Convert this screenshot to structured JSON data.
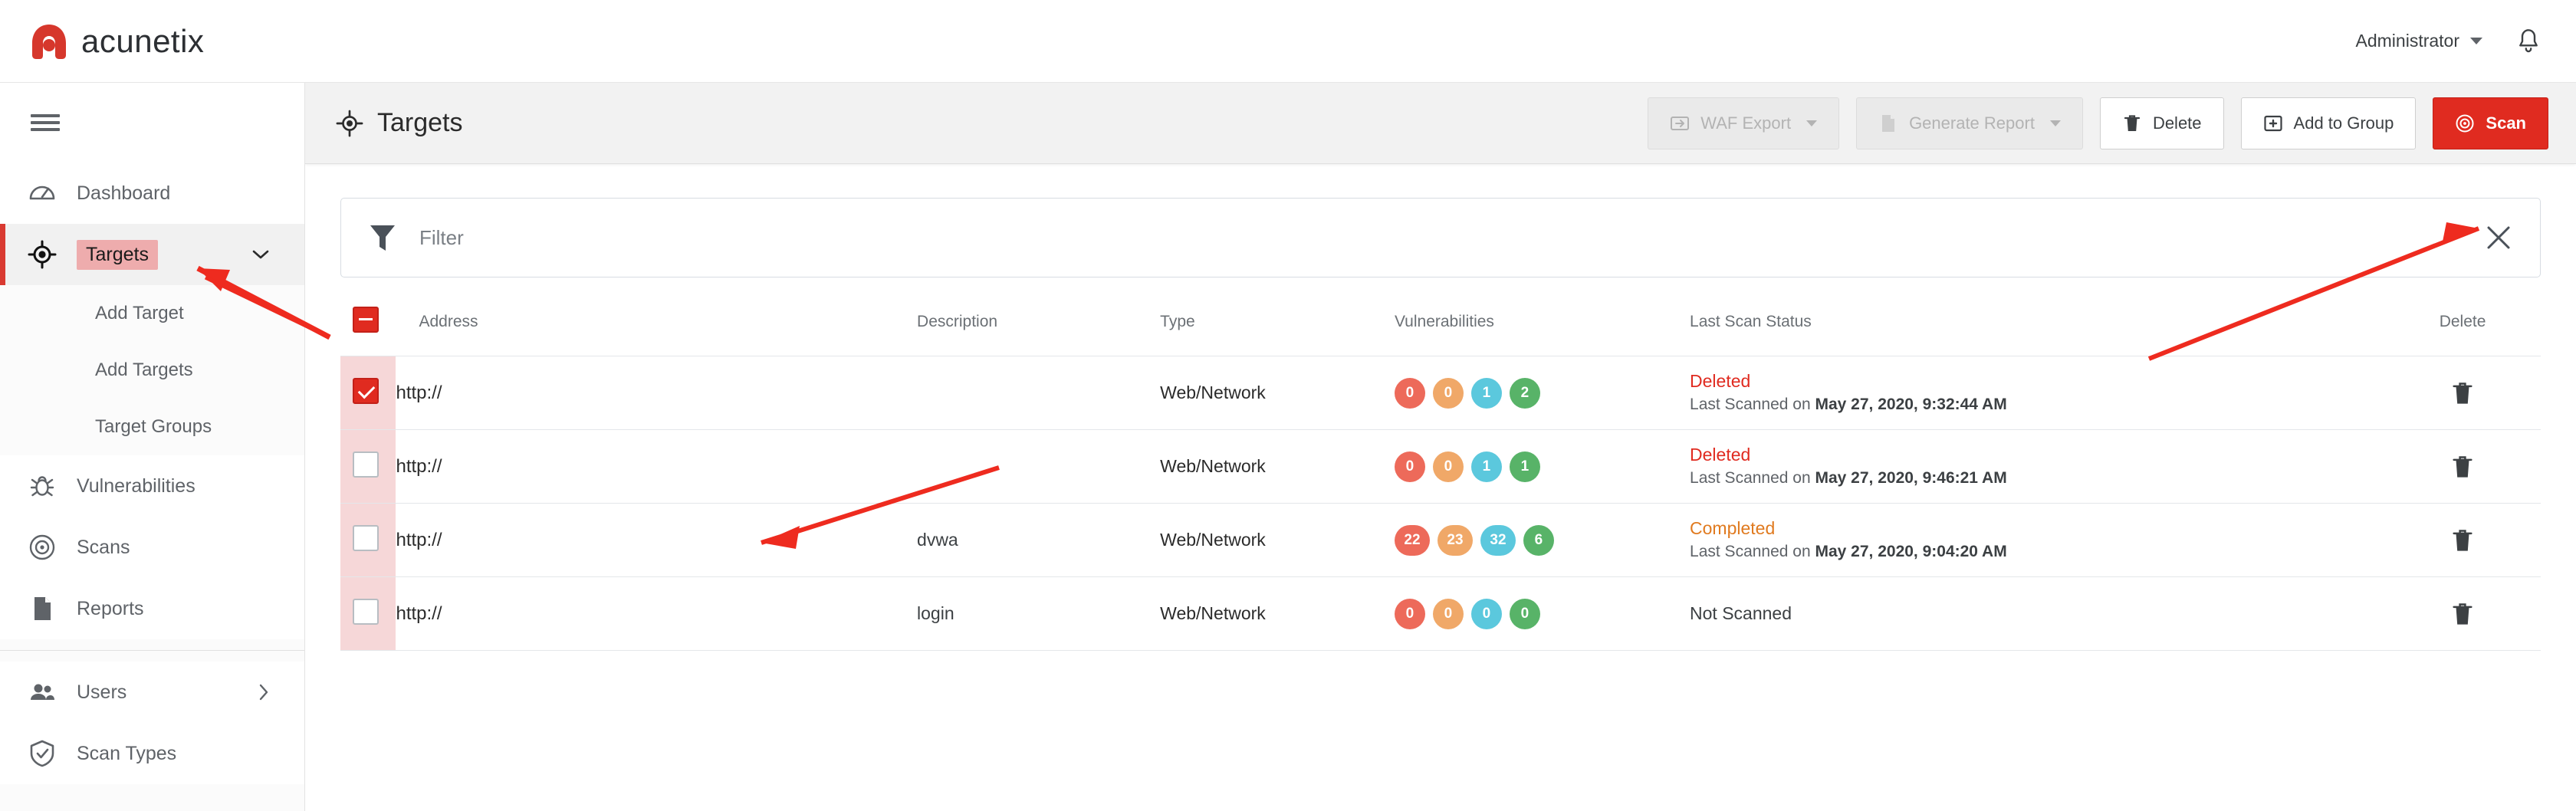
{
  "brand": {
    "name": "acunetix",
    "logo_icon": "acunetix-logo-icon"
  },
  "topbar": {
    "user_label": "Administrator",
    "user_caret_icon": "chevron-down-icon",
    "notifications_icon": "bell-icon"
  },
  "sidebar": {
    "menu_icon": "hamburger-menu-icon",
    "items": [
      {
        "label": "Dashboard",
        "icon": "dashboard-gauge-icon",
        "active": false,
        "expandable": false
      },
      {
        "label": "Targets",
        "icon": "crosshair-target-icon",
        "active": true,
        "expandable": true,
        "chevron_icon": "chevron-down-icon"
      },
      {
        "label": "Vulnerabilities",
        "icon": "bug-icon",
        "active": false,
        "expandable": false
      },
      {
        "label": "Scans",
        "icon": "radar-scan-icon",
        "active": false,
        "expandable": false
      },
      {
        "label": "Reports",
        "icon": "document-report-icon",
        "active": false,
        "expandable": false
      },
      {
        "label": "Users",
        "icon": "users-icon",
        "active": false,
        "expandable": true,
        "chevron_icon": "chevron-right-icon"
      },
      {
        "label": "Scan Types",
        "icon": "shield-icon",
        "active": false,
        "expandable": false
      }
    ],
    "sub_items": [
      {
        "label": "Add Target"
      },
      {
        "label": "Add Targets"
      },
      {
        "label": "Target Groups"
      }
    ]
  },
  "page": {
    "title": "Targets",
    "title_icon": "crosshair-target-icon"
  },
  "toolbar": {
    "buttons": [
      {
        "label": "WAF Export",
        "icon": "waf-export-icon",
        "disabled": true,
        "caret": true,
        "primary": false
      },
      {
        "label": "Generate Report",
        "icon": "report-page-icon",
        "disabled": true,
        "caret": true,
        "primary": false
      },
      {
        "label": "Delete",
        "icon": "trash-icon",
        "disabled": false,
        "caret": false,
        "primary": false
      },
      {
        "label": "Add to Group",
        "icon": "add-to-group-icon",
        "disabled": false,
        "caret": false,
        "primary": false
      },
      {
        "label": "Scan",
        "icon": "scan-radar-icon",
        "disabled": false,
        "caret": false,
        "primary": true
      }
    ]
  },
  "filter": {
    "icon": "funnel-filter-icon",
    "placeholder": "Filter",
    "clear_icon": "close-x-icon"
  },
  "table": {
    "select_all_state": "indeterminate",
    "columns": [
      "Address",
      "Description",
      "Type",
      "Vulnerabilities",
      "Last Scan Status",
      "Delete"
    ],
    "severity_colors": {
      "high": "#ed6a5a",
      "medium": "#f0a868",
      "low": "#5bc8dd",
      "info": "#58b368"
    },
    "status_colors": {
      "deleted": "#e02b20",
      "completed": "#e07a1f",
      "not_scanned": "#3c4043"
    },
    "rows": [
      {
        "checked": true,
        "address": "http://",
        "description": "",
        "type": "Web/Network",
        "vulnerabilities": {
          "high": "0",
          "medium": "0",
          "low": "1",
          "info": "2"
        },
        "status": "Deleted",
        "status_kind": "deleted",
        "scanned_prefix": "Last Scanned on ",
        "scanned_date": "May 27, 2020, 9:32:44 AM",
        "delete_icon": "trash-icon"
      },
      {
        "checked": false,
        "address": "http://",
        "description": "",
        "type": "Web/Network",
        "vulnerabilities": {
          "high": "0",
          "medium": "0",
          "low": "1",
          "info": "1"
        },
        "status": "Deleted",
        "status_kind": "deleted",
        "scanned_prefix": "Last Scanned on ",
        "scanned_date": "May 27, 2020, 9:46:21 AM",
        "delete_icon": "trash-icon"
      },
      {
        "checked": false,
        "address": "http://",
        "description": "dvwa",
        "type": "Web/Network",
        "vulnerabilities": {
          "high": "22",
          "medium": "23",
          "low": "32",
          "info": "6"
        },
        "status": "Completed",
        "status_kind": "completed",
        "scanned_prefix": "Last Scanned on ",
        "scanned_date": "May 27, 2020, 9:04:20 AM",
        "delete_icon": "trash-icon"
      },
      {
        "checked": false,
        "address": "http://",
        "description": "login",
        "type": "Web/Network",
        "vulnerabilities": {
          "high": "0",
          "medium": "0",
          "low": "0",
          "info": "0"
        },
        "status": "Not Scanned",
        "status_kind": "not_scanned",
        "scanned_prefix": "",
        "scanned_date": "",
        "delete_icon": "trash-icon"
      }
    ]
  },
  "annotations": {
    "color": "#ee2b1f",
    "arrows": [
      {
        "name": "arrow-to-targets-nav"
      },
      {
        "name": "arrow-to-first-row-address"
      },
      {
        "name": "arrow-to-scan-button"
      }
    ]
  }
}
